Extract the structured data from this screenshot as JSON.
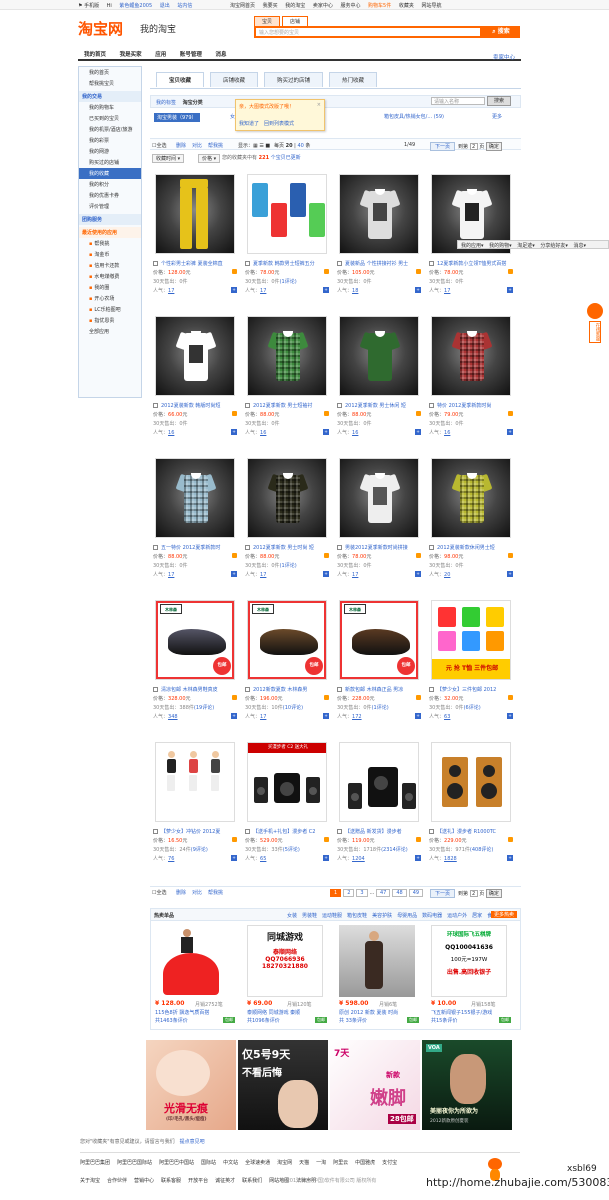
{
  "topbar": {
    "left": [
      "⚑ 手机版",
      "Hi",
      "紫色鲤鱼2005",
      "退出",
      "站内信"
    ],
    "right": [
      "淘宝网首页",
      "我要买",
      "我的淘宝",
      "卖家中心",
      "服务中心",
      "购物车5件",
      "收藏夹",
      "网站导航"
    ]
  },
  "header": {
    "logo": "淘宝网",
    "logo_sub": "我的淘宝",
    "search_tabs": [
      "宝贝",
      "店铺"
    ],
    "search_placeholder": "输入您想要的宝贝",
    "search_button": "搜索"
  },
  "nav": {
    "items": [
      "我的首页",
      "我是买家",
      "应用",
      "账号管理",
      "消息"
    ],
    "right": "卖家中心"
  },
  "sidebar": {
    "top": [
      "我的首页",
      "帮我挑宝贝"
    ],
    "sec1": "我的交易",
    "trade": [
      "我的购物车",
      "已买到的宝贝",
      "我的机票/酒店/旅游",
      "我的彩票",
      "我的网游",
      "购买过的店铺",
      "我的收藏",
      "我的积分",
      "我的优惠卡券",
      "评价管理"
    ],
    "sec2": "团购服务",
    "sec3": "最近使用的应用",
    "apps": [
      "帮我挑",
      "淘金币",
      "信用卡还款",
      "水电煤缴费",
      "我的圈",
      "开心农场",
      "LC乐柏图吧",
      "指优恩贵",
      "全部应用"
    ]
  },
  "tabs": [
    "宝贝收藏",
    "店铺收藏",
    "购买过的店铺",
    "热门收藏"
  ],
  "subnav": {
    "items": [
      "我的标签",
      "淘宝分类"
    ],
    "search_placeholder": "请输入名称",
    "search_btn": "搜索"
  },
  "category": {
    "selected": "淘宝男装（979）",
    "mid": "女",
    "right": "箱包皮具/热销女包/... (59)",
    "more": "更多"
  },
  "tooltip": {
    "line1": "亲，大图模式改版了哦！",
    "line2": "我知道了",
    "line3": "回到列表模式"
  },
  "toolbar": {
    "left": [
      "全选",
      "删除",
      "对比",
      "帮我挑"
    ],
    "display_label": "显示：",
    "per_page_label": "每页",
    "per_page": [
      "20",
      "40",
      "条"
    ],
    "page_info": "1/49",
    "next": "下一页",
    "goto_label": "到第",
    "goto_value": "2",
    "goto_unit": "页",
    "confirm": "确定"
  },
  "sortrow": {
    "time": "收藏时间",
    "price": "价格",
    "notice_pre": "您的收藏夹中有",
    "notice_count": "221",
    "notice_post": "个宝贝已更新"
  },
  "products": [
    {
      "title": "个性彩男士彩裤 夏装全棉直",
      "price": "128.00",
      "sold": "0件",
      "pop": "17"
    },
    {
      "title": "夏季新款 韩款男士短裤五分",
      "price": "78.00",
      "sold": "0件",
      "reviews": "(1评论)",
      "pop": "17"
    },
    {
      "title": "夏装新品 个性拼接衬衫 男士",
      "price": "105.00",
      "sold": "0件",
      "pop": "18"
    },
    {
      "title": "12夏季新款小立领T恤男式百搭",
      "price": "78.00",
      "sold": "0件",
      "pop": "17"
    },
    {
      "title": "2012夏装新款 韩版时尚短",
      "price": "66.00",
      "sold": "0件",
      "pop": "16"
    },
    {
      "title": "2012夏季新款 男士短袖衬",
      "price": "88.00",
      "sold": "0件",
      "pop": "16"
    },
    {
      "title": "2012夏季新款 男士休闲 短",
      "price": "88.00",
      "sold": "0件",
      "pop": "16"
    },
    {
      "title": "特价 2012夏季新款时尚",
      "price": "79.00",
      "sold": "0件",
      "pop": "16"
    },
    {
      "title": "五一特价 2012夏季新款时",
      "price": "88.00",
      "sold": "0件",
      "pop": "17"
    },
    {
      "title": "2012夏季新款 男士时尚 短",
      "price": "88.00",
      "sold": "0件",
      "reviews": "(1评论)",
      "pop": "17"
    },
    {
      "title": "男装2012夏季新款时尚拼接",
      "price": "78.00",
      "sold": "0件",
      "pop": "17"
    },
    {
      "title": "2012夏装新款休闲男士短",
      "price": "98.00",
      "sold": "0件",
      "pop": "20"
    },
    {
      "title": "清凉包邮 木林森男鞋真皮",
      "price": "328.00",
      "sold": "388件",
      "reviews": "(19评论)",
      "pop": "348"
    },
    {
      "title": "2012新款夏款 木林森男",
      "price": "196.00",
      "sold": "10件",
      "reviews": "(10评论)",
      "pop": "17"
    },
    {
      "title": "新款包邮 木林森正品 男凉",
      "price": "228.00",
      "sold": "0件",
      "reviews": "(1评论)",
      "pop": "172"
    },
    {
      "title": "【萝少女】三件包邮 2012",
      "price": "32.00",
      "sold": "0件",
      "reviews": "(6评论)",
      "pop": "63"
    },
    {
      "title": "【萝少女】冲钻价 2012夏",
      "price": "16.50",
      "sold": "24件",
      "reviews": "(9评论)",
      "pop": "76"
    },
    {
      "title": "【送手机+礼包】漫步者 C2",
      "price": "529.00",
      "sold": "33件",
      "reviews": "(5评论)",
      "pop": "65"
    },
    {
      "title": "【送赠品 新发货】漫步者",
      "price": "119.00",
      "sold": "1718件",
      "reviews": "(2314评论)",
      "pop": "1204"
    },
    {
      "title": "【送礼】漫步者 R1000TC",
      "price": "229.00",
      "sold": "971件",
      "reviews": "(408评论)",
      "pop": "1828"
    }
  ],
  "labels": {
    "price": "价格：",
    "yuan": "元",
    "sold30": "30天售出：",
    "popularity": "人气："
  },
  "pager": {
    "left": [
      "全选",
      "删除",
      "对比",
      "帮我挑"
    ],
    "pages": [
      "1",
      "2",
      "3",
      "...",
      "47",
      "48",
      "49"
    ],
    "next": "下一页",
    "goto_label": "到第",
    "goto_value": "2",
    "goto_unit": "页",
    "confirm": "确定"
  },
  "hot": {
    "title": "热卖单品",
    "cats": [
      "女装",
      "男装鞋",
      "运动鞋服",
      "箱包皮鞋",
      "美容护肤",
      "母婴用品",
      "数码电器",
      "运动户外",
      "居家",
      "食品"
    ],
    "more": "更多热卖",
    "items": [
      {
        "price": "¥ 128.00",
        "monthly": "月销2752笔",
        "desc": "115色8折 飘逸气质百搭",
        "reviews": "共1463条评价",
        "tag": "包邮"
      },
      {
        "price": "¥ 69.00",
        "monthly": "月销120笔",
        "desc": "泰顺网络 同城游戏 秦顺",
        "reviews": "共1096条评价",
        "tag": "包邮"
      },
      {
        "price": "¥ 598.00",
        "monthly": "月销6笔",
        "desc": "原创 2012 新款 夏装 时尚",
        "reviews": "共 33条评价",
        "tag": "包邮"
      },
      {
        "price": "¥ 10.00",
        "monthly": "月销158笔",
        "desc": "飞五新闻银子155银子/游戏",
        "reviews": "共15条评价",
        "tag": "包邮"
      }
    ],
    "banner_text": {
      "g2_title": "同城游戏",
      "g2_sub": "泰顺网络",
      "g2_qq": "QQ7066936",
      "g2_tel": "18270321880",
      "g4_title": "环球国际飞五棋牌",
      "g4_qq": "QQ100041636",
      "g4_sub": "100元=197W",
      "g4_sub2": "出售.高回收银子"
    }
  },
  "ads": [
    {
      "text": "光滑无痕",
      "sub": "(印/毛孔/黑头/痘痘)"
    },
    {
      "text": "仅5号9天",
      "sub": "不看后悔"
    },
    {
      "text": "嫩脚",
      "sub": "28包邮"
    },
    {
      "text": "美丽夜你为所欲为",
      "sub": "VOA"
    }
  ],
  "ad_extra": {
    "a3_top": "7天",
    "a3_new": "新款",
    "a4_sub2": "2012新款原创夏装"
  },
  "fav_link": "您对\"收藏夹\"有意见或建议，请留言与我们",
  "fav_link2": "提点意见吧",
  "footer": {
    "row1": [
      "阿里巴巴集团",
      "阿里巴巴国际站",
      "阿里巴巴中国站",
      "国际站",
      "中文站",
      "全球速卖通",
      "淘宝网",
      "天猫",
      "一淘",
      "阿里云",
      "中国雅虎",
      "支付宝"
    ],
    "row2": [
      "关于淘宝",
      "合作伙伴",
      "营销中心",
      "联系客服",
      "开放平台",
      "诚征英才",
      "联系我们",
      "网站地图",
      "法律声明"
    ],
    "copyright": "© 2012 淘宝(中国)软件有限公司 版权所有"
  },
  "floatbar": [
    "我的应用▾",
    "我的购物▾",
    "淘足迹▾",
    "分享给好友▾",
    "消息▾"
  ],
  "side_widget": "在线客服",
  "watermark": {
    "user": "xsbl69",
    "url": "http://home.zhubajie.com/5300835/"
  }
}
